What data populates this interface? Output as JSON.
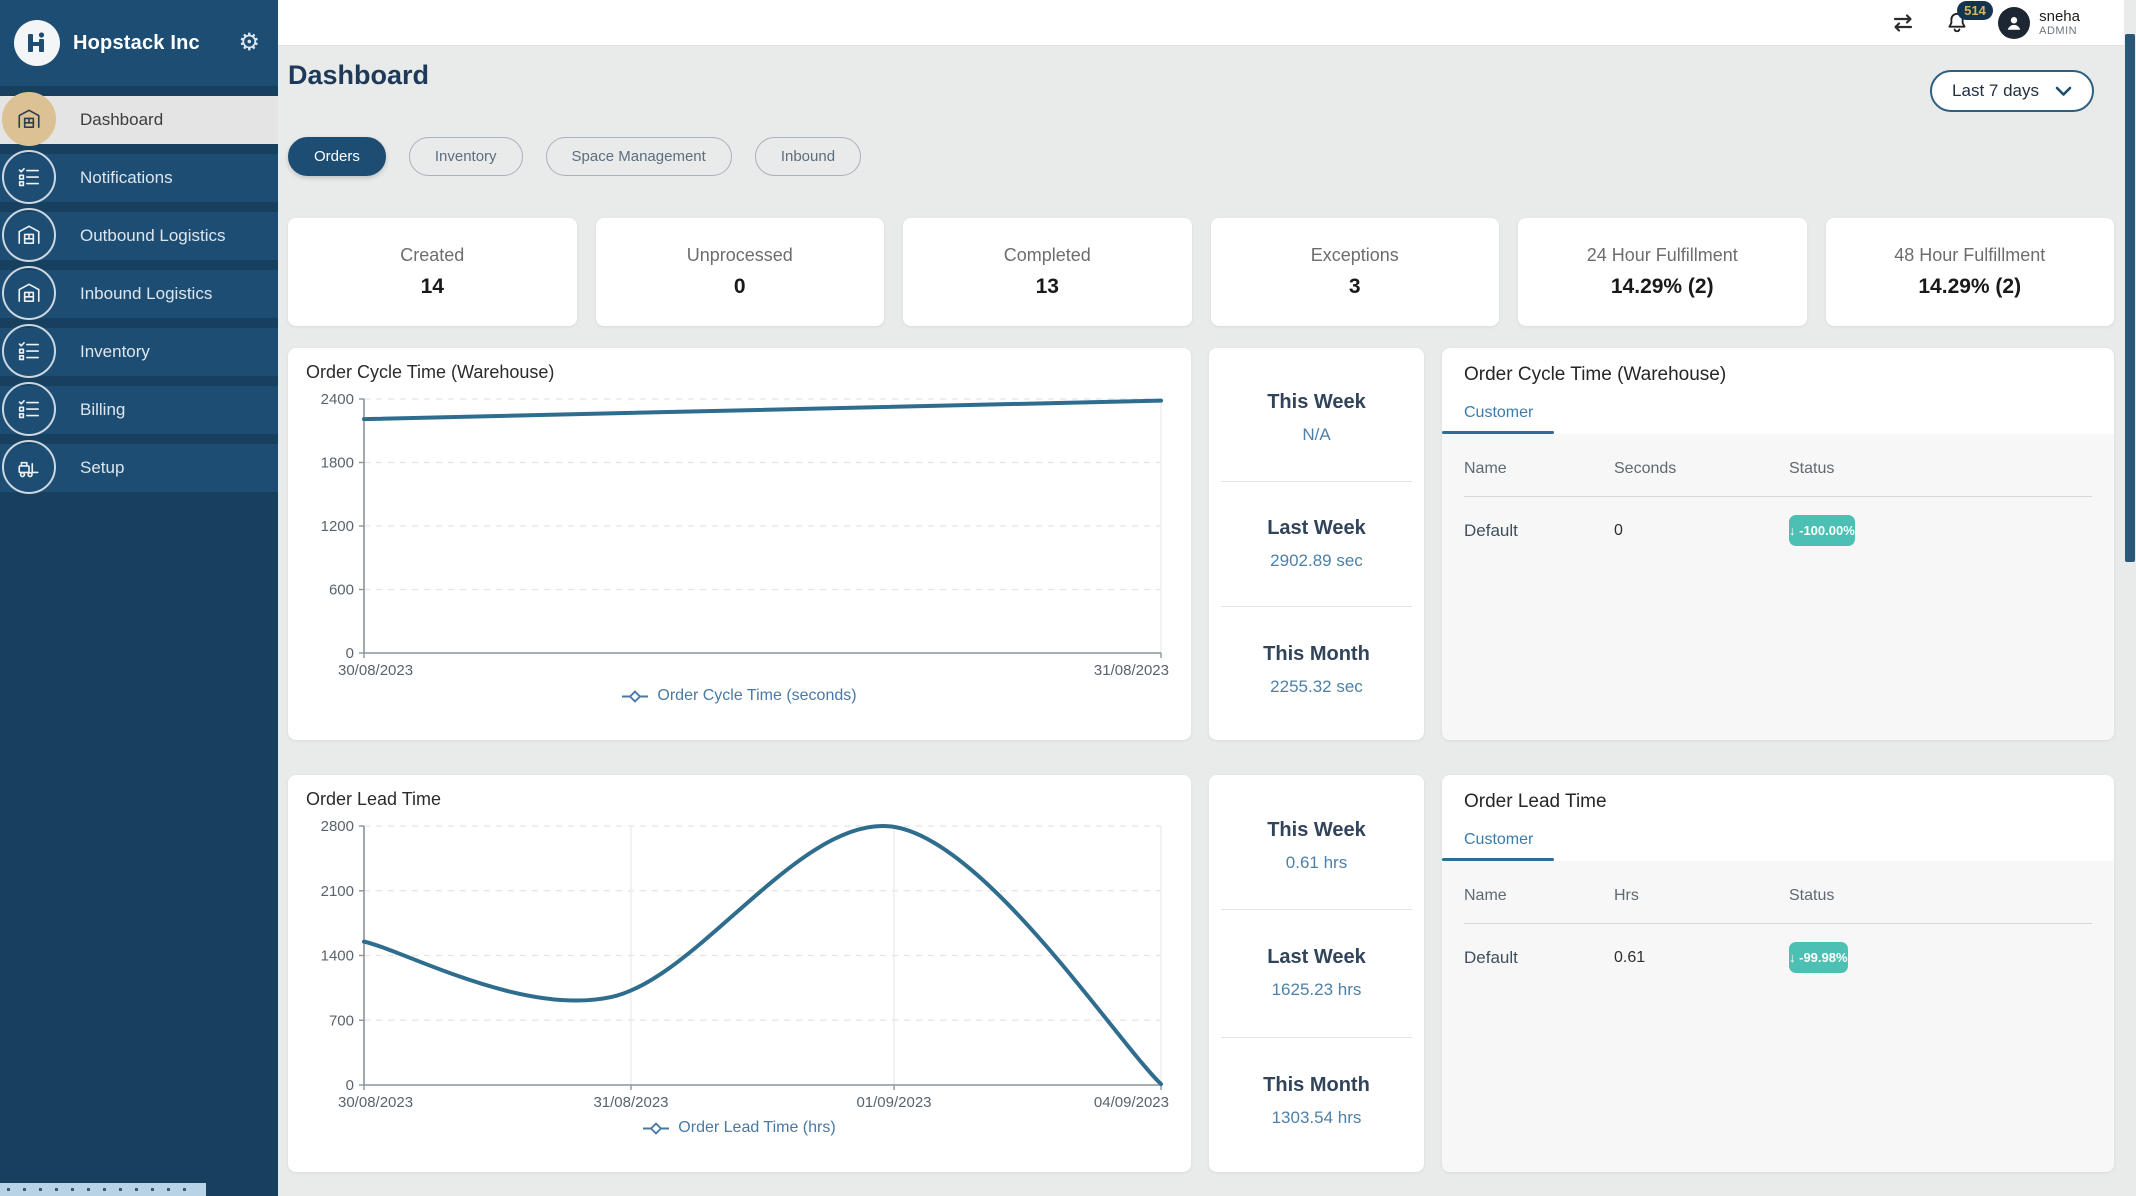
{
  "app": {
    "company": "Hopstack Inc"
  },
  "topbar": {
    "notification_count": "514",
    "user_name": "sneha",
    "user_role": "ADMIN"
  },
  "sidebar": {
    "items": [
      {
        "label": "Dashboard",
        "icon": "warehouse",
        "active": true
      },
      {
        "label": "Notifications",
        "icon": "checklist",
        "active": false
      },
      {
        "label": "Outbound Logistics",
        "icon": "warehouse",
        "active": false
      },
      {
        "label": "Inbound Logistics",
        "icon": "warehouse",
        "active": false
      },
      {
        "label": "Inventory",
        "icon": "checklist",
        "active": false
      },
      {
        "label": "Billing",
        "icon": "checklist",
        "active": false
      },
      {
        "label": "Setup",
        "icon": "forklift",
        "active": false
      }
    ]
  },
  "header": {
    "title": "Dashboard",
    "date_filter": "Last 7 days"
  },
  "tabs": [
    {
      "label": "Orders",
      "active": true
    },
    {
      "label": "Inventory",
      "active": false
    },
    {
      "label": "Space Management",
      "active": false
    },
    {
      "label": "Inbound",
      "active": false
    }
  ],
  "stats": [
    {
      "label": "Created",
      "value": "14"
    },
    {
      "label": "Unprocessed",
      "value": "0"
    },
    {
      "label": "Completed",
      "value": "13"
    },
    {
      "label": "Exceptions",
      "value": "3"
    },
    {
      "label": "24 Hour Fulfillment",
      "value": "14.29% (2)"
    },
    {
      "label": "48 Hour Fulfillment",
      "value": "14.29% (2)"
    }
  ],
  "summary_panels": [
    {
      "sections": [
        {
          "label": "This Week",
          "value": "N/A"
        },
        {
          "label": "Last Week",
          "value": "2902.89 sec"
        },
        {
          "label": "This Month",
          "value": "2255.32 sec"
        }
      ]
    },
    {
      "sections": [
        {
          "label": "This Week",
          "value": "0.61 hrs"
        },
        {
          "label": "Last Week",
          "value": "1625.23 hrs"
        },
        {
          "label": "This Month",
          "value": "1303.54 hrs"
        }
      ]
    }
  ],
  "tables": [
    {
      "title": "Order Cycle Time (Warehouse)",
      "tab": "Customer",
      "columns": [
        "Name",
        "Seconds",
        "Status"
      ],
      "rows": [
        {
          "name": "Default",
          "value": "0",
          "status": "↓ -100.00%"
        }
      ]
    },
    {
      "title": "Order Lead Time",
      "tab": "Customer",
      "columns": [
        "Name",
        "Hrs",
        "Status"
      ],
      "rows": [
        {
          "name": "Default",
          "value": "0.61",
          "status": "↓ -99.98%"
        }
      ]
    }
  ],
  "chart_data": [
    {
      "type": "line",
      "title": "Order Cycle Time (Warehouse)",
      "legend": "Order Cycle Time (seconds)",
      "ylabel": "seconds",
      "ylim": [
        0,
        2400
      ],
      "y_ticks": [
        0,
        600,
        1200,
        1800,
        2400
      ],
      "x_ticks": [
        {
          "label": "30/08/2023",
          "pos": 0
        },
        {
          "label": "31/08/2023",
          "pos": 1
        }
      ],
      "points": [
        {
          "x": "30/08/2023",
          "pos": 0,
          "y": 2210
        },
        {
          "x": "31/08/2023",
          "pos": 1,
          "y": 2385
        }
      ],
      "line_color": "#2e6d8e",
      "grid": true,
      "legend_position": "bottom"
    },
    {
      "type": "line",
      "title": "Order Lead Time",
      "legend": "Order Lead Time (hrs)",
      "ylabel": "hrs",
      "ylim": [
        0,
        2800
      ],
      "y_ticks": [
        0,
        700,
        1400,
        2100,
        2800
      ],
      "x_ticks": [
        {
          "label": "30/08/2023",
          "pos": 0
        },
        {
          "label": "31/08/2023",
          "pos": 0.335
        },
        {
          "label": "01/09/2023",
          "pos": 0.665
        },
        {
          "label": "04/09/2023",
          "pos": 1
        }
      ],
      "points": [
        {
          "x": "30/08/2023",
          "pos": 0,
          "y": 1550
        },
        {
          "x": "31/08/2023",
          "pos": 0.31,
          "y": 950
        },
        {
          "x": "01/09/2023",
          "pos": 0.665,
          "y": 2790
        },
        {
          "x": "04/09/2023",
          "pos": 1,
          "y": 10
        }
      ],
      "line_color": "#2e6d8e",
      "grid": true,
      "legend_position": "bottom"
    }
  ],
  "colors": {
    "sidebar": "#1d4d72",
    "active_icon_circle": "#dcc194",
    "badge_teal": "#4cc0b2",
    "value_blue": "#4d80a8",
    "chart_line": "#2e6d8e",
    "notification_badge_bg": "#14344f",
    "notification_badge_text": "#d9b45c"
  }
}
